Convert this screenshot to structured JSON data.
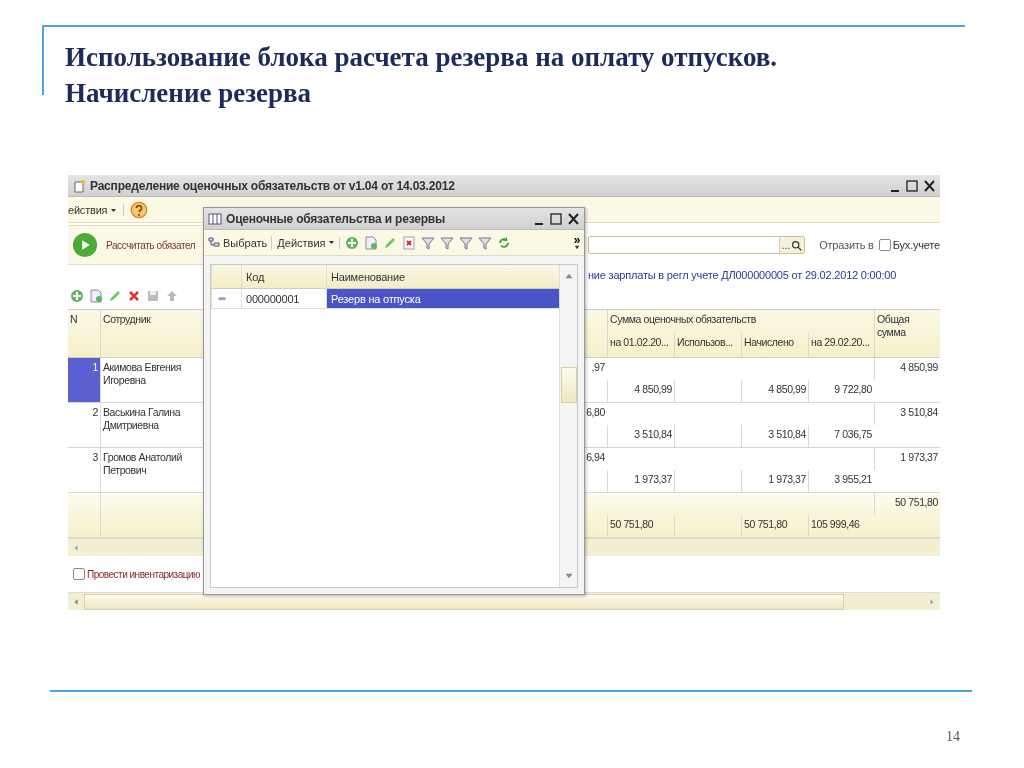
{
  "slide": {
    "title_lines": [
      "Использование блока расчета резерва на оплату отпусков.",
      "Начисление резерва"
    ],
    "page_number": "14"
  },
  "main_window": {
    "title": "Распределение оценочных обязательств от v1.04 от 14.03.2012",
    "menu": "ействия",
    "calc_button": "Рассчитать обязател",
    "search_button": "...",
    "reflect_label": "Отразить в",
    "accounting_checkbox": {
      "label": "Бух.учете",
      "checked": false
    },
    "document_link": "ние зарплаты в регл учете ДЛ000000005 от 29.02.2012 0:00:00",
    "table": {
      "columns": {
        "n": "N",
        "employee": "Сотрудник",
        "group": "Сумма оценочных обязательств",
        "at_start": "на 01.02.20...",
        "used": "Использов...",
        "accrued": "Начислено",
        "at_end": "на 29.02.20...",
        "total": "Общая сумма"
      },
      "rows": [
        {
          "n": "1",
          "employee": "Акимова Евгения Игоревна",
          "selected": true,
          "column_3": ",97",
          "at_start": "4 850,99",
          "accrued": "4 850,99",
          "at_end": "9 722,80",
          "total": "4 850,99"
        },
        {
          "n": "2",
          "employee": "Васькина Галина Дмитриевна",
          "selected": false,
          "column_3": "6,80",
          "at_start": "3 510,84",
          "accrued": "3 510,84",
          "at_end": "7 036,75",
          "total": "3 510,84"
        },
        {
          "n": "3",
          "employee": "Громов Анатолий Петрович",
          "selected": false,
          "column_3": "6,94",
          "at_start": "1 973,37",
          "accrued": "1 973,37",
          "at_end": "3 955,21",
          "total": "1 973,37"
        }
      ],
      "footer": {
        "total": "50 751,80",
        "at_start": "50 751,80",
        "accrued": "50 751,80",
        "at_end": "105 999,46"
      }
    },
    "inventory_checkbox": {
      "label": "Провести инвентаризацию",
      "checked": false
    }
  },
  "dialog": {
    "title": "Оценочные обязательства и резервы",
    "select_button": "Выбрать",
    "actions_menu": "Действия",
    "more_button": "»",
    "table": {
      "columns": [
        "Код",
        "Наименование"
      ],
      "rows": [
        {
          "code": "000000001",
          "name": "Резерв на отпуска",
          "selected": true
        }
      ]
    }
  }
}
